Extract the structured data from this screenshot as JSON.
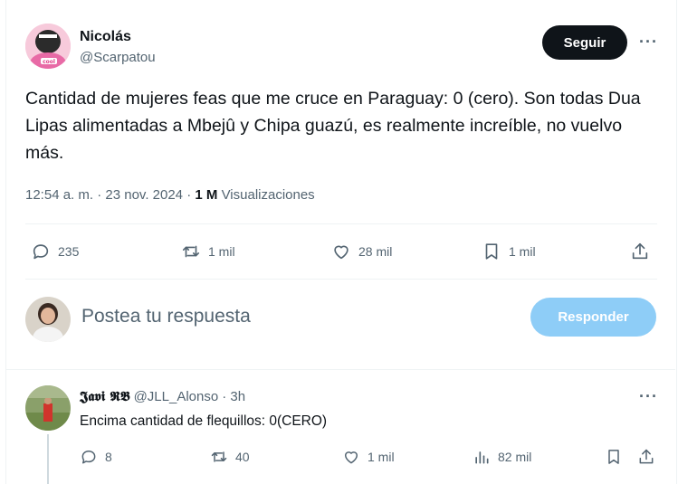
{
  "tweet": {
    "author_name": "Nicolás",
    "author_handle": "@Scarpatou",
    "follow_label": "Seguir",
    "more_label": "···",
    "text": "Cantidad de mujeres feas que me cruce en Paraguay: 0 (cero). Son todas Dua Lipas alimentadas a Mbejû y Chipa guazú, es realmente increíble, no vuelvo más.",
    "time": "12:54 a. m.",
    "sep": "·",
    "date": "23 nov. 2024",
    "views_count": "1 M",
    "views_label": "Visualizaciones",
    "stats": {
      "replies": "235",
      "retweets": "1 mil",
      "likes": "28 mil",
      "bookmarks": "1 mil"
    }
  },
  "composer": {
    "placeholder": "Postea tu respuesta",
    "reply_label": "Responder"
  },
  "reply": {
    "author_name": "𝕵𝖆𝖛𝖎 𝕽𝕭",
    "author_handle": "@JLL_Alonso",
    "time": "· 3h",
    "more_label": "···",
    "text": "Encima cantidad de flequillos: 0(CERO)",
    "stats": {
      "replies": "8",
      "retweets": "40",
      "likes": "1 mil",
      "views": "82 mil"
    }
  },
  "colors": {
    "text": "#0f1419",
    "muted": "#536471",
    "accent_disabled": "#8ecdf7",
    "border": "#eff3f4"
  }
}
